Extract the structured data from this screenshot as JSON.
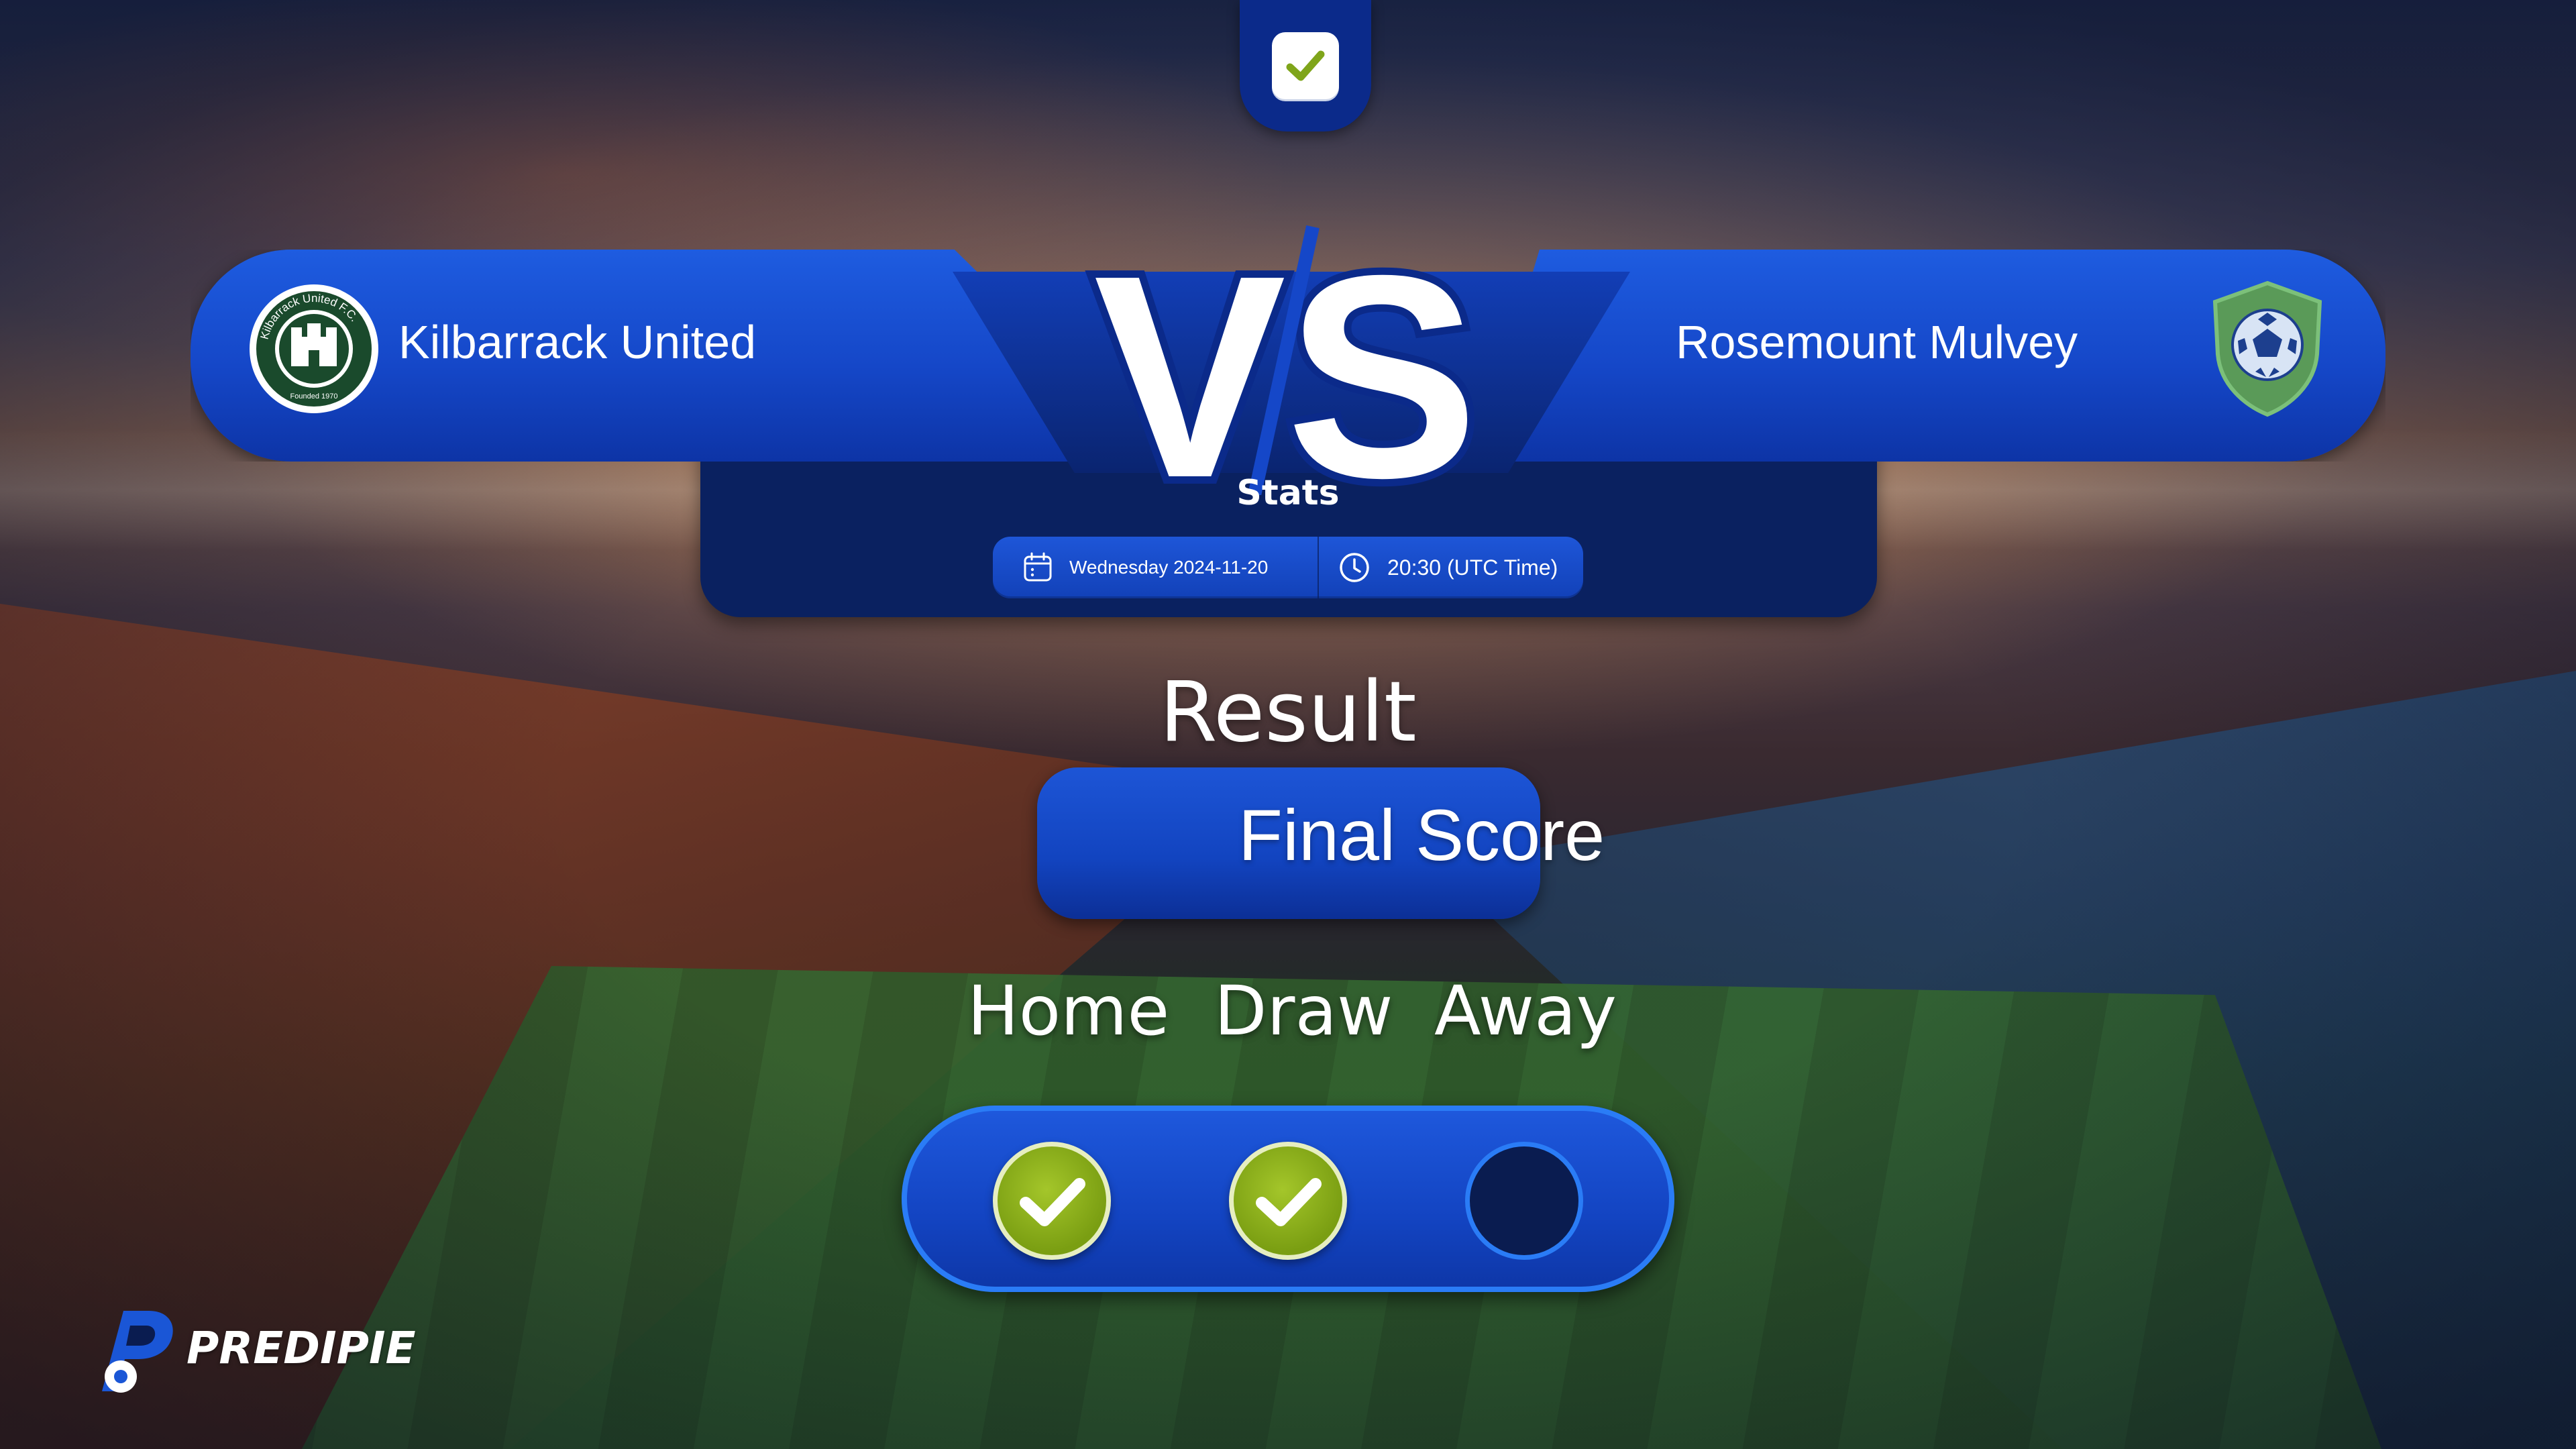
{
  "match": {
    "home_team": "Kilbarrack United",
    "away_team": "Rosemount Mulvey",
    "vs_text": "VS",
    "stats_label": "Stats",
    "date": "Wednesday 2024-11-20",
    "time": "20:30 (UTC Time)"
  },
  "home_crest": {
    "icon": "kilbarrack-united-crest-icon",
    "ring_text": "Kilbarrack United F.C.",
    "founded_text": "Founded 1970",
    "color": "#1a4a2c"
  },
  "away_crest": {
    "icon": "soccer-ball-shield-icon",
    "color": "#5a9a58"
  },
  "result": {
    "title": "Result",
    "type_label": "Final Score"
  },
  "outcomes": {
    "home_label": "Home",
    "draw_label": "Draw",
    "away_label": "Away",
    "home_selected": true,
    "draw_selected": true,
    "away_selected": false
  },
  "brand": {
    "name": "PREDIPIE",
    "accent": "#1a56d6"
  }
}
